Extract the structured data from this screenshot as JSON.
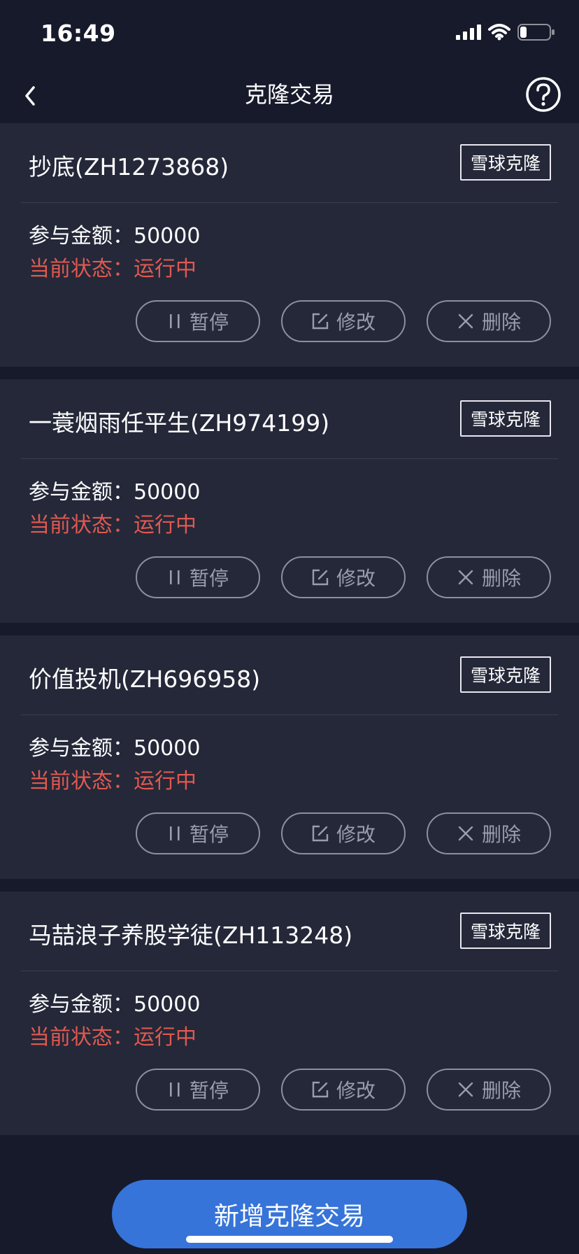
{
  "status_bar": {
    "time": "16:49"
  },
  "nav": {
    "title": "克隆交易"
  },
  "cards": [
    {
      "title": "抄底(ZH1273868)",
      "tag": "雪球克隆",
      "amount_label": "参与金额：",
      "amount_value": "50000",
      "status_label": "当前状态：",
      "status_value": "运行中",
      "pause_label": "暂停",
      "edit_label": "修改",
      "delete_label": "删除"
    },
    {
      "title": "一蓑烟雨任平生(ZH974199)",
      "tag": "雪球克隆",
      "amount_label": "参与金额：",
      "amount_value": "50000",
      "status_label": "当前状态：",
      "status_value": "运行中",
      "pause_label": "暂停",
      "edit_label": "修改",
      "delete_label": "删除"
    },
    {
      "title": "价值投机(ZH696958)",
      "tag": "雪球克隆",
      "amount_label": "参与金额：",
      "amount_value": "50000",
      "status_label": "当前状态：",
      "status_value": "运行中",
      "pause_label": "暂停",
      "edit_label": "修改",
      "delete_label": "删除"
    },
    {
      "title": "马喆浪子养股学徒(ZH113248)",
      "tag": "雪球克隆",
      "amount_label": "参与金额：",
      "amount_value": "50000",
      "status_label": "当前状态：",
      "status_value": "运行中",
      "pause_label": "暂停",
      "edit_label": "修改",
      "delete_label": "删除"
    }
  ],
  "bottom": {
    "add_label": "新增克隆交易"
  },
  "colors": {
    "background": "#171a2b",
    "card": "#242839",
    "status_text": "#e0594f",
    "primary_button": "#3674d9"
  },
  "icons": {
    "back": "chevron-left-icon",
    "help": "question-circle-icon",
    "pause": "pause-icon",
    "edit": "edit-icon",
    "delete": "close-icon",
    "signal": "signal-icon",
    "wifi": "wifi-icon",
    "battery": "battery-icon"
  }
}
